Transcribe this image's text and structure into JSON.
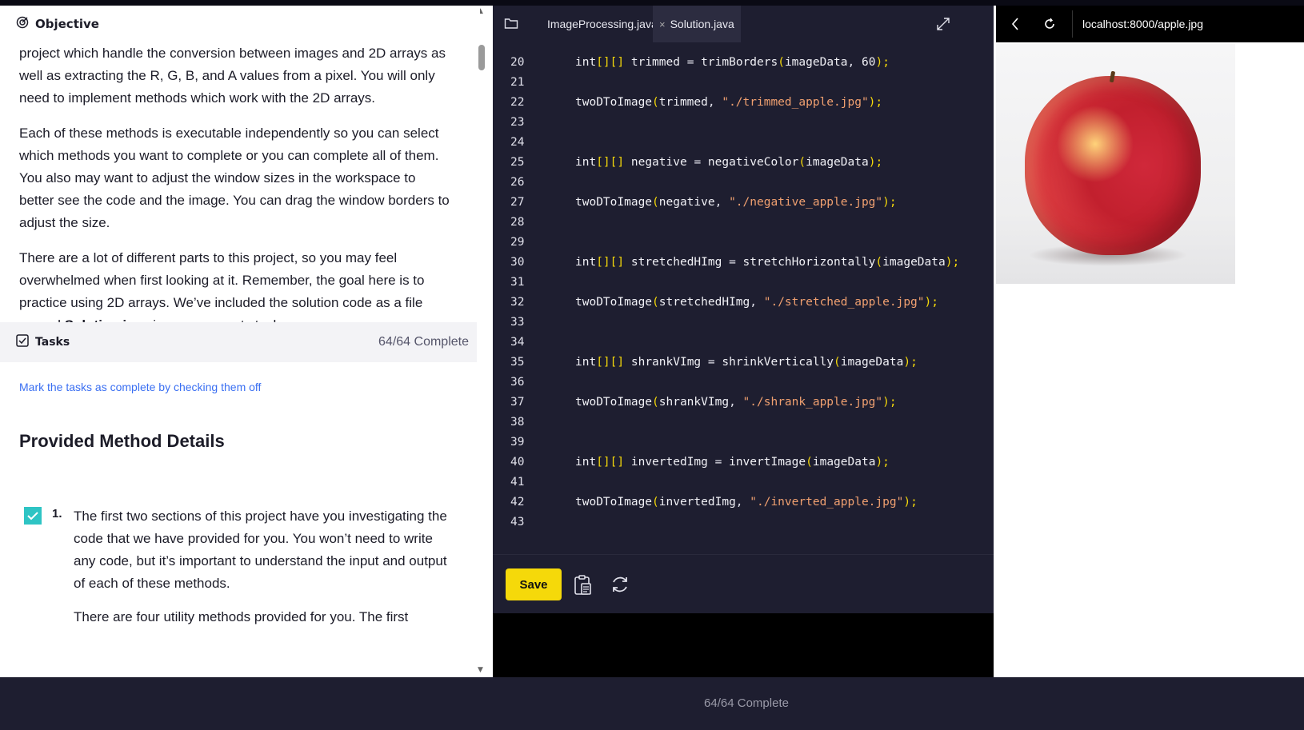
{
  "objective": {
    "title": "Objective",
    "paragraphs": [
      "project which handle the conversion between images and 2D arrays as well as extracting the R, G, B, and A values from a pixel. You will only need to implement methods which work with the 2D arrays.",
      "Each of these methods is executable independently so you can select which methods you want to complete or you can complete all of them. You also may want to adjust the window sizes in the workspace to better see the code and the image. You can drag the window borders to adjust the size."
    ],
    "para3_before": "There are a lot of different parts to this project, so you may feel overwhelmed when first looking at it. Remember, the goal here is to practice using 2D arrays. We’ve included the solution code as a file named ",
    "para3_bold": "Solution.java",
    "para3_after": " in case you get stuck."
  },
  "tasks": {
    "label": "Tasks",
    "count": "64/64 Complete",
    "mark_link": "Mark the tasks as complete by checking them off",
    "section_heading": "Provided Method Details",
    "items": [
      {
        "number": "1.",
        "text": "The first two sections of this project have you investigating the code that we have provided for you. You won’t need to write any code, but it’s important to understand the input and output of each of these methods.",
        "text2": "There are four utility methods provided for you. The first"
      }
    ]
  },
  "editor": {
    "tabs": [
      {
        "label": "ImageProcessing.java",
        "active": false
      },
      {
        "label": "Solution.java",
        "active": true
      }
    ],
    "code_lines": [
      {
        "n": "20",
        "t": "int[][] trimmed = trimBorders(imageData, 60);"
      },
      {
        "n": "21",
        "t": ""
      },
      {
        "n": "22",
        "t": "twoDToImage(trimmed, \"./trimmed_apple.jpg\");"
      },
      {
        "n": "23",
        "t": ""
      },
      {
        "n": "24",
        "t": ""
      },
      {
        "n": "25",
        "t": "int[][] negative = negativeColor(imageData);"
      },
      {
        "n": "26",
        "t": ""
      },
      {
        "n": "27",
        "t": "twoDToImage(negative, \"./negative_apple.jpg\");"
      },
      {
        "n": "28",
        "t": ""
      },
      {
        "n": "29",
        "t": ""
      },
      {
        "n": "30",
        "t": "int[][] stretchedHImg = stretchHorizontally(imageData);"
      },
      {
        "n": "31",
        "t": ""
      },
      {
        "n": "32",
        "t": "twoDToImage(stretchedHImg, \"./stretched_apple.jpg\");"
      },
      {
        "n": "33",
        "t": ""
      },
      {
        "n": "34",
        "t": ""
      },
      {
        "n": "35",
        "t": "int[][] shrankVImg = shrinkVertically(imageData);"
      },
      {
        "n": "36",
        "t": ""
      },
      {
        "n": "37",
        "t": "twoDToImage(shrankVImg, \"./shrank_apple.jpg\");"
      },
      {
        "n": "38",
        "t": ""
      },
      {
        "n": "39",
        "t": ""
      },
      {
        "n": "40",
        "t": "int[][] invertedImg = invertImage(imageData);"
      },
      {
        "n": "41",
        "t": ""
      },
      {
        "n": "42",
        "t": "twoDToImage(invertedImg, \"./inverted_apple.jpg\");"
      },
      {
        "n": "43",
        "t": ""
      }
    ],
    "save_label": "Save",
    "icons": [
      "folder-icon",
      "close-icon",
      "expand-icon",
      "clipboard-icon",
      "refresh-icon"
    ]
  },
  "browser": {
    "url": "localhost:8000/apple.jpg",
    "icons": [
      "back-icon",
      "reload-icon"
    ]
  },
  "status": {
    "text": "64/64 Complete"
  },
  "colors": {
    "accent_yellow": "#f5d90a",
    "editor_bg": "#1e1e30",
    "check_teal": "#2ec4c4",
    "link_blue": "#3a6ff2"
  }
}
